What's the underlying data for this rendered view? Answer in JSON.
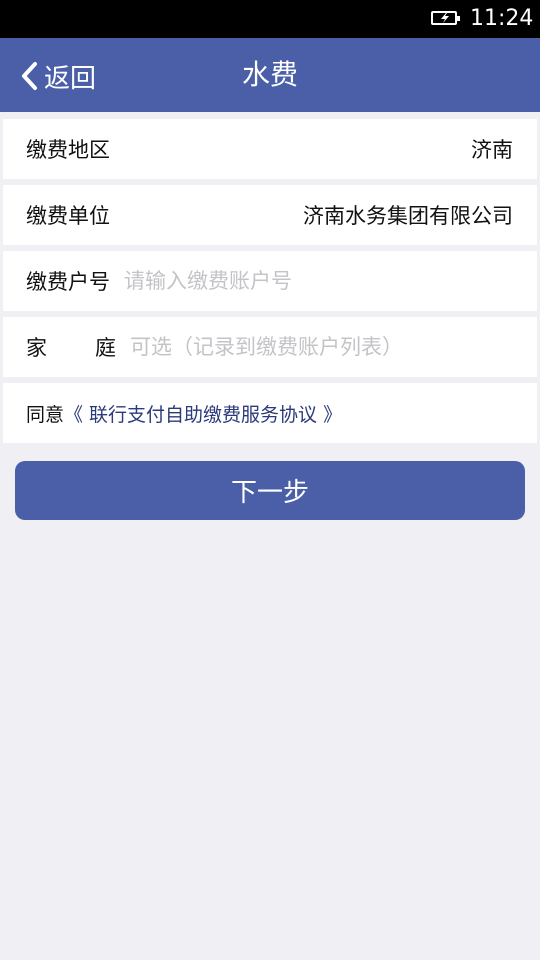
{
  "status_bar": {
    "time": "11:24",
    "battery_icon": "battery-charging-icon"
  },
  "nav": {
    "back_icon": "chevron-left-icon",
    "back_label": "返回",
    "title": "水费"
  },
  "form": {
    "region": {
      "label": "缴费地区",
      "value": "济南"
    },
    "company": {
      "label": "缴费单位",
      "value": "济南水务集团有限公司"
    },
    "account": {
      "label": "缴费户号",
      "value": "",
      "placeholder": "请输入缴费账户号"
    },
    "family": {
      "label_part1": "家",
      "label_part2": "庭",
      "value": "",
      "placeholder": "可选（记录到缴费账户列表）"
    },
    "agreement": {
      "prefix": "同意",
      "link": "《 联行支付自助缴费服务协议 》"
    }
  },
  "actions": {
    "next_label": "下一步"
  },
  "colors": {
    "primary": "#4a5fa8",
    "background": "#efeff4",
    "placeholder": "#c4c4c8"
  }
}
